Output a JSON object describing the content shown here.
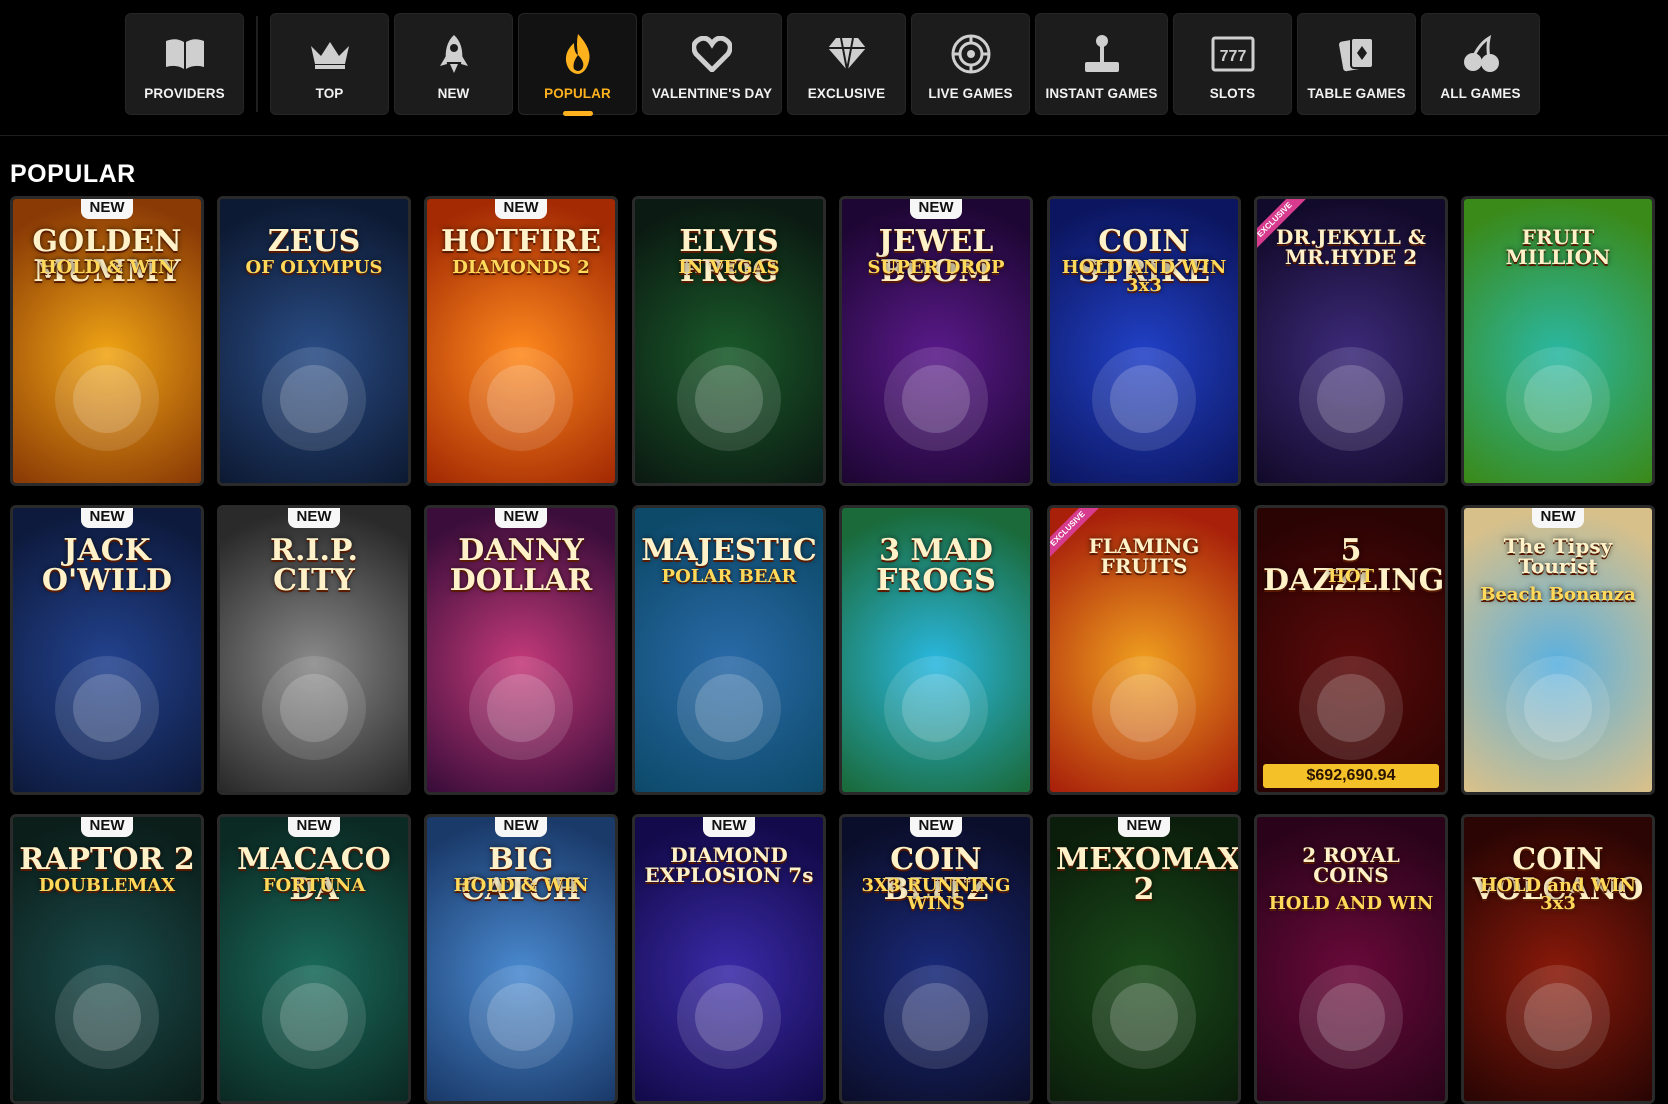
{
  "nav": {
    "categories": [
      {
        "label": "PROVIDERS",
        "icon": "book-icon"
      },
      {
        "label": "TOP",
        "icon": "crown-icon"
      },
      {
        "label": "NEW",
        "icon": "rocket-icon"
      },
      {
        "label": "POPULAR",
        "icon": "flame-icon",
        "active": true
      },
      {
        "label": "VALENTINE'S DAY",
        "icon": "heart-icon"
      },
      {
        "label": "EXCLUSIVE",
        "icon": "diamond-icon"
      },
      {
        "label": "LIVE GAMES",
        "icon": "roulette-icon"
      },
      {
        "label": "INSTANT GAMES",
        "icon": "joystick-icon"
      },
      {
        "label": "SLOTS",
        "icon": "slot-777-icon"
      },
      {
        "label": "TABLE GAMES",
        "icon": "cards-icon"
      },
      {
        "label": "ALL GAMES",
        "icon": "cherries-icon"
      }
    ]
  },
  "section": {
    "title": "POPULAR"
  },
  "badges": {
    "new": "NEW",
    "exclusive": "EXCLUSIVE"
  },
  "games": [
    {
      "t1": "GOLDEN MUMMY",
      "t2": "HOLD & WIN",
      "badge": "NEW",
      "bg": [
        "#f0a515",
        "#8a3a05"
      ]
    },
    {
      "t1": "ZEUS",
      "t2": "OF OLYMPUS",
      "bg": [
        "#2a4d86",
        "#0d1a33"
      ]
    },
    {
      "t1": "HOTFIRE",
      "t2": "DIAMONDS 2",
      "badge": "NEW",
      "bg": [
        "#ff8a1e",
        "#a32a03"
      ]
    },
    {
      "t1": "ELVIS FROG",
      "t2": "IN VEGAS",
      "bg": [
        "#1a5a2a",
        "#0b1a12"
      ]
    },
    {
      "t1": "JEWEL BOOM",
      "t2": "SUPER DROP",
      "badge": "NEW",
      "bg": [
        "#5a1a8a",
        "#1d0633"
      ]
    },
    {
      "t1": "COIN STRIKE",
      "t2": "HOLD AND WIN 3x3",
      "bg": [
        "#2141c7",
        "#0c1660"
      ]
    },
    {
      "t1": "DR.JEKYLL & MR.HYDE 2",
      "t2": "",
      "exclusive": true,
      "bg": [
        "#3d2a7a",
        "#120a2a"
      ]
    },
    {
      "t1": "FRUIT MILLION",
      "t2": "",
      "bg": [
        "#2bb8a4",
        "#3a8a1a"
      ]
    },
    {
      "t1": "JACK O'WILD",
      "t2": "",
      "badge": "NEW",
      "bg": [
        "#23438f",
        "#0d1a3d"
      ]
    },
    {
      "t1": "R.I.P. CITY",
      "t2": "",
      "badge": "NEW",
      "bg": [
        "#8a8a8a",
        "#2a2a2a"
      ]
    },
    {
      "t1": "DANNY DOLLAR",
      "t2": "",
      "badge": "NEW",
      "bg": [
        "#c43a7a",
        "#3a0d3a"
      ]
    },
    {
      "t1": "MAJESTIC",
      "t2": "POLAR BEAR",
      "bg": [
        "#2a6aa8",
        "#0d4a6a"
      ]
    },
    {
      "t1": "3 MAD FROGS",
      "t2": "",
      "bg": [
        "#2ab8e0",
        "#1a6a3a"
      ]
    },
    {
      "t1": "FLAMING FRUITS",
      "t2": "",
      "exclusive": true,
      "bg": [
        "#f0a020",
        "#a8200a"
      ]
    },
    {
      "t1": "5 DAZZLING",
      "t2": "HOT",
      "jackpot": "$692,690.94",
      "bg": [
        "#5a0a0a",
        "#2a0303"
      ]
    },
    {
      "t1": "The Tipsy Tourist",
      "t2": "Beach Bonanza",
      "badge": "NEW",
      "bg": [
        "#5ab0e0",
        "#d8c08a"
      ]
    },
    {
      "t1": "RAPTOR 2",
      "t2": "DOUBLEMAX",
      "badge": "NEW",
      "bg": [
        "#1a4a4a",
        "#0b1e1a"
      ]
    },
    {
      "t1": "MACACO DA",
      "t2": "FORTUNA",
      "badge": "NEW",
      "bg": [
        "#1a6a5a",
        "#0b2a24"
      ]
    },
    {
      "t1": "BIG CATCH",
      "t2": "HOLD & WIN",
      "badge": "NEW",
      "bg": [
        "#4a8ad0",
        "#1a3a6a"
      ]
    },
    {
      "t1": "DIAMOND EXPLOSION 7s",
      "t2": "",
      "badge": "NEW",
      "bg": [
        "#3a2aa8",
        "#120a4a"
      ]
    },
    {
      "t1": "COIN BLITZ",
      "t2": "3X3 RUNNING WINS",
      "badge": "NEW",
      "bg": [
        "#1a2a7a",
        "#0b0e2a"
      ]
    },
    {
      "t1": "MEXOMAX 2",
      "t2": "",
      "badge": "NEW",
      "bg": [
        "#1a4a1a",
        "#0b1e0b"
      ]
    },
    {
      "t1": "2 ROYAL COINS",
      "t2": "HOLD AND WIN",
      "bg": [
        "#6a0a3a",
        "#2a031a"
      ]
    },
    {
      "t1": "COIN VOLCANO",
      "t2": "HOLD and WIN 3x3",
      "bg": [
        "#8a1a0a",
        "#2a0503"
      ]
    }
  ]
}
